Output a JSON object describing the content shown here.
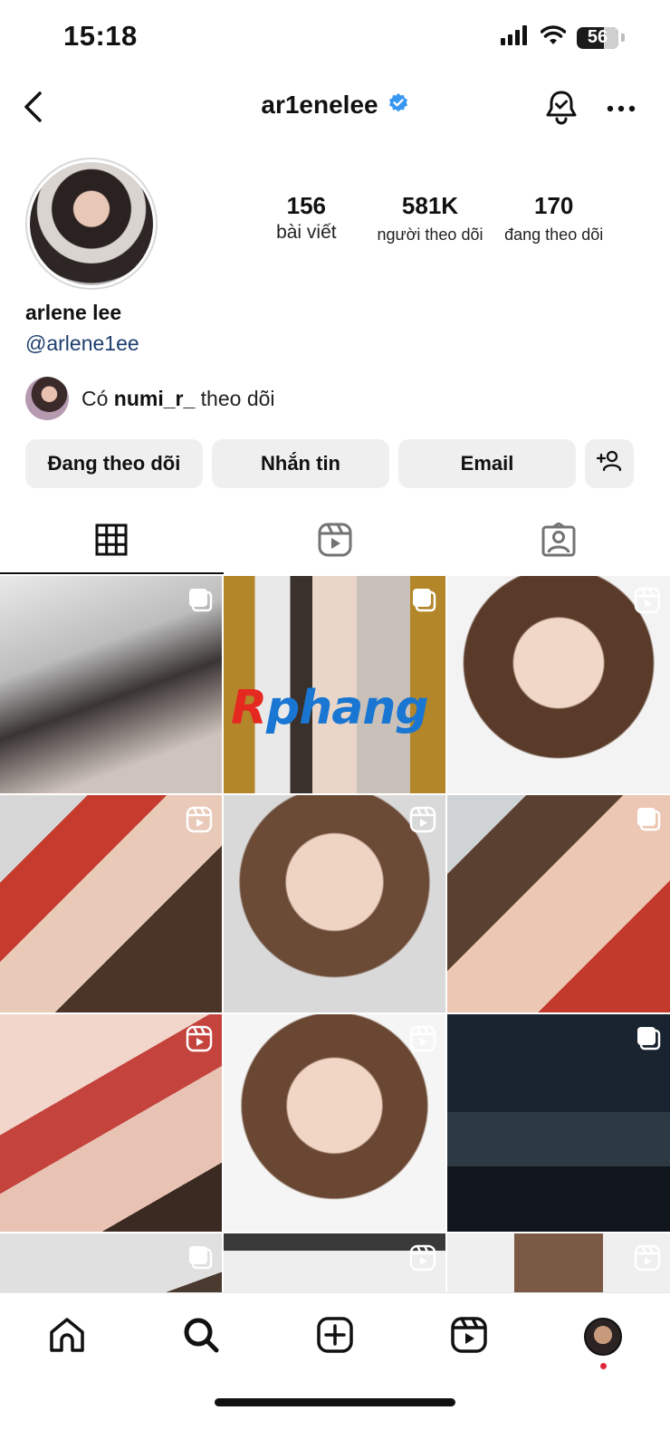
{
  "status_bar": {
    "time": "15:18",
    "battery": "56",
    "icons": [
      "signal-icon",
      "wifi-icon",
      "battery-icon"
    ]
  },
  "header": {
    "username": "ar1enelee",
    "verified": true,
    "icons": [
      "back-icon",
      "bell-icon",
      "more-icon"
    ]
  },
  "profile": {
    "stats": {
      "posts_value": "156",
      "posts_label": "bài viết",
      "followers_value": "581K",
      "followers_label": "người theo dõi",
      "following_value": "170",
      "following_label": "đang theo dõi"
    },
    "display_name": "arlene lee",
    "handle": "@arlene1ee",
    "followed_by": {
      "prefix": "Có",
      "name": "numi_r_",
      "suffix": "theo dõi"
    }
  },
  "actions": {
    "following_label": "Đang theo dõi",
    "message_label": "Nhắn tin",
    "email_label": "Email",
    "add_icon": "add-person-icon"
  },
  "tabs": {
    "items": [
      "grid-icon",
      "reels-icon",
      "tagged-icon"
    ],
    "active": "grid-icon"
  },
  "grid": {
    "posts": [
      {
        "type": "carousel"
      },
      {
        "type": "carousel"
      },
      {
        "type": "reel"
      },
      {
        "type": "reel"
      },
      {
        "type": "reel"
      },
      {
        "type": "carousel"
      },
      {
        "type": "reel"
      },
      {
        "type": "reel"
      },
      {
        "type": "carousel"
      },
      {
        "type": "carousel"
      },
      {
        "type": "reel"
      },
      {
        "type": "reel"
      }
    ],
    "watermark": "Rphang"
  },
  "bottom_nav": {
    "items": [
      "home-icon",
      "search-icon",
      "create-icon",
      "reels-icon",
      "profile-avatar"
    ]
  },
  "colors": {
    "verified_blue": "#3897f0",
    "button_bg": "#efefef",
    "handle_blue": "#1e3e70",
    "notification_red": "#e0263b"
  }
}
